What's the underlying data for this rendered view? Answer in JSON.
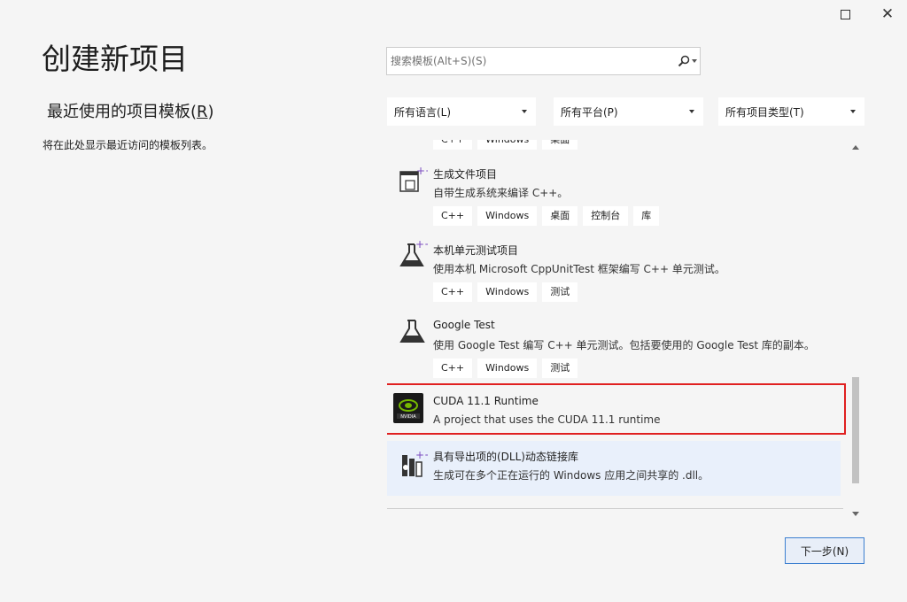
{
  "window": {
    "title": "创建新项目"
  },
  "recent": {
    "header": "最近使用的项目模板",
    "header_key": "R",
    "empty_text": "将在此处显示最近访问的模板列表。"
  },
  "search": {
    "placeholder": "搜索模板(Alt+S)(S)"
  },
  "filters": [
    {
      "label": "所有语言(L)"
    },
    {
      "label": "所有平台(P)"
    },
    {
      "label": "所有项目类型(T)"
    }
  ],
  "templates": [
    {
      "title": "",
      "description": "",
      "tags": [
        "C++",
        "Windows",
        "桌面"
      ],
      "icon": "partial-item"
    },
    {
      "title": "生成文件项目",
      "description": "自带生成系统来编译 C++。",
      "tags": [
        "C++",
        "Windows",
        "桌面",
        "控制台",
        "库"
      ],
      "icon": "makefile-project-icon"
    },
    {
      "title": "本机单元测试项目",
      "description": "使用本机 Microsoft CppUnitTest 框架编写 C++ 单元测试。",
      "tags": [
        "C++",
        "Windows",
        "测试"
      ],
      "icon": "flask-plus-icon"
    },
    {
      "title": "Google Test",
      "description": "使用 Google Test 编写 C++ 单元测试。包括要使用的 Google Test 库的副本。",
      "tags": [
        "C++",
        "Windows",
        "测试"
      ],
      "icon": "flask-icon"
    },
    {
      "title": "CUDA 11.1 Runtime",
      "description": "A project that uses the CUDA 11.1 runtime",
      "tags": [],
      "icon": "nvidia-logo-icon"
    },
    {
      "title": "具有导出项的(DLL)动态链接库",
      "description": "生成可在多个正在运行的 Windows 应用之间共享的 .dll。",
      "tags": [],
      "icon": "dll-library-icon"
    }
  ],
  "footer": {
    "next_label": "下一步(N)"
  },
  "colors": {
    "background": "#f5f5f5",
    "selection_border": "#e02020",
    "hover_background": "#e9f0fb",
    "button_border": "#3c7fd0"
  }
}
